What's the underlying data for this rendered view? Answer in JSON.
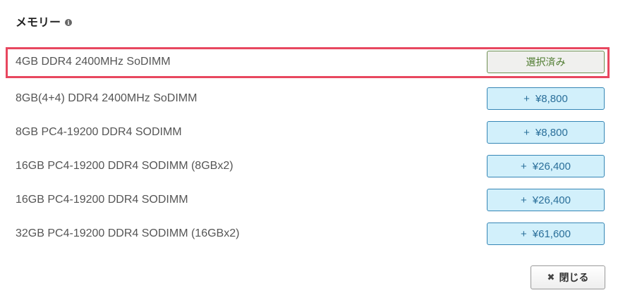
{
  "header": {
    "title": "メモリー",
    "info_icon": "info-circle-icon"
  },
  "options": [
    {
      "label": "4GB DDR4 2400MHz SoDIMM",
      "button": "選択済み",
      "selected": true
    },
    {
      "label": "8GB(4+4) DDR4 2400MHz SoDIMM",
      "plus": "+",
      "price": "¥8,800",
      "selected": false
    },
    {
      "label": "8GB PC4-19200 DDR4 SODIMM",
      "plus": "+",
      "price": "¥8,800",
      "selected": false
    },
    {
      "label": "16GB PC4-19200 DDR4 SODIMM (8GBx2)",
      "plus": "+",
      "price": "¥26,400",
      "selected": false
    },
    {
      "label": "16GB PC4-19200 DDR4 SODIMM",
      "plus": "+",
      "price": "¥26,400",
      "selected": false
    },
    {
      "label": "32GB PC4-19200 DDR4 SODIMM (16GBx2)",
      "plus": "+",
      "price": "¥61,600",
      "selected": false
    }
  ],
  "footer": {
    "close_icon_glyph": "✖",
    "close_label": "閉じる"
  },
  "colors": {
    "selected_border": "#e8475f",
    "price_button_bg": "#d2f0fb",
    "price_button_border": "#3586b5",
    "selected_button_text": "#4d7a2e"
  }
}
